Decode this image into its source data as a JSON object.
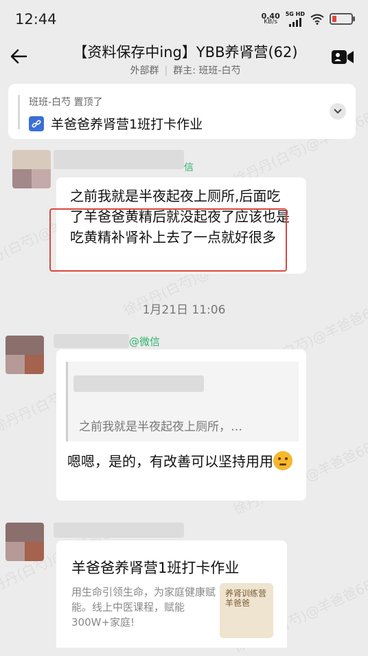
{
  "status": {
    "time": "12:44",
    "speed_value": "0.40",
    "speed_unit": "KB/s",
    "network": "5G HD"
  },
  "header": {
    "title": "【资料保存中ing】YBB养肾营(62)",
    "group_type": "外部群",
    "owner": "群主: 班班-白芍"
  },
  "pinned": {
    "meta": "班班-白芍 置顶了",
    "title": "羊爸爸养肾营1班打卡作业"
  },
  "messages": [
    {
      "name_fragment": "信",
      "text": "之前我就是半夜起夜上厕所,后面吃了羊爸爸黄精后就没起夜了应该也是吃黄精补肾补上去了一点就好很多"
    },
    {
      "timestamp": "1月21日  11:06"
    },
    {
      "name_fragment": "@微信",
      "quote": "之前我就是半夜起夜上厕所，…",
      "text": "嗯嗯，是的，有改善可以坚持用用"
    },
    {
      "card_title": "羊爸爸养肾营1班打卡作业",
      "card_desc": "用生命引领生命，为家庭健康赋能。线上中医课程，赋能300W+家庭!",
      "thumb_text": "养肾训练营 羊爸爸"
    }
  ],
  "watermark": "徐丹丹(白芍)@羊爸爸68",
  "colors": {
    "background": "#ececec",
    "highlight": "#d9473b",
    "wechat_green": "#2db36b",
    "link_icon": "#3a6fd8"
  }
}
